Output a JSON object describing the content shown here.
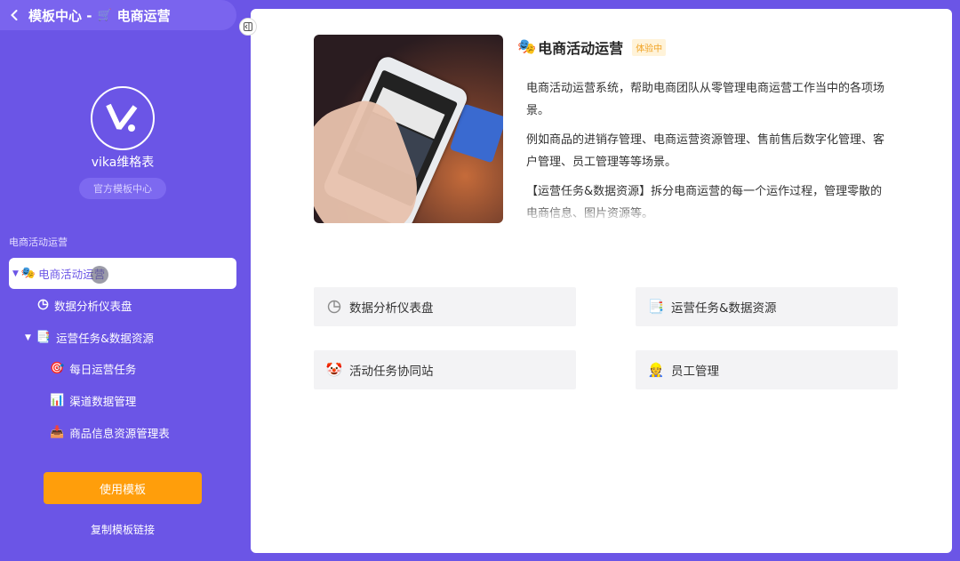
{
  "header": {
    "title_prefix": "模板中心 -",
    "title_emoji": "🛒",
    "title_name": "电商运营"
  },
  "sidebar": {
    "brand": "vika维格表",
    "badge": "官方模板中心",
    "section_label": "电商活动运营",
    "tree": [
      {
        "label": "电商活动运营",
        "icon": "🎭",
        "active": true
      },
      {
        "label": "数据分析仪表盘",
        "icon": "dashboard-icon"
      },
      {
        "label": "运营任务&数据资源",
        "icon": "📑"
      },
      {
        "label": "每日运营任务",
        "icon": "🎯"
      },
      {
        "label": "渠道数据管理",
        "icon": "📊"
      },
      {
        "label": "商品信息资源管理表",
        "icon": "📥"
      }
    ],
    "use_button": "使用模板",
    "copy_link": "复制模板链接"
  },
  "main": {
    "emoji": "🎭",
    "title": "电商活动运营",
    "badge": "体验中",
    "paragraphs": [
      "电商活动运营系统，帮助电商团队从零管理电商运营工作当中的各项场景。",
      "例如商品的进销存管理、电商运营资源管理、售前售后数字化管理、客户管理、员工管理等等场景。",
      "【运营任务&数据资源】拆分电商运营的每一个运作过程，管理零散的电商信息、图片资源等。"
    ],
    "cards": [
      {
        "label": "数据分析仪表盘",
        "icon": "dashboard-icon"
      },
      {
        "label": "运营任务&数据资源",
        "icon": "📑"
      },
      {
        "label": "活动任务协同站",
        "icon": "🤡"
      },
      {
        "label": "员工管理",
        "icon": "👷"
      }
    ]
  },
  "colors": {
    "background": "#6b55e6",
    "active_item_text": "#6b55e6",
    "use_button": "#ff9e0b",
    "badge_bg": "#fff3d9",
    "badge_text": "#f0a325"
  }
}
